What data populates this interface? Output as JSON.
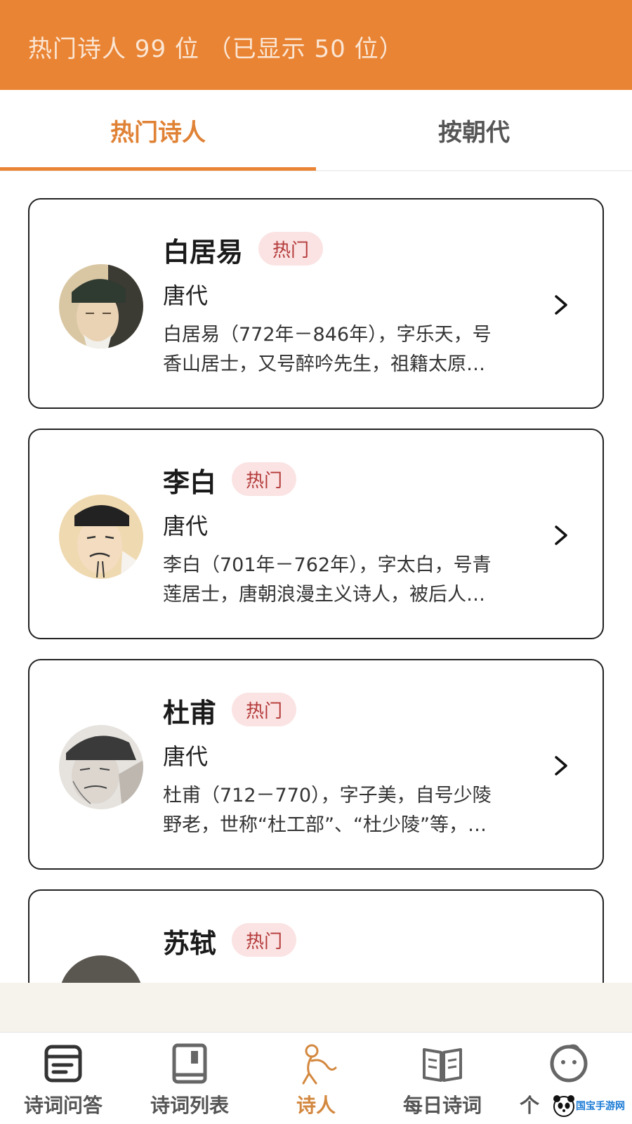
{
  "header": {
    "title": "热门诗人 99 位  （已显示 50 位）"
  },
  "tabs": [
    {
      "label": "热门诗人",
      "active": true
    },
    {
      "label": "按朝代",
      "active": false
    }
  ],
  "poets": [
    {
      "name": "白居易",
      "badge": "热门",
      "dynasty": "唐代",
      "desc_line1": "白居易（772年－846年），字乐天，号",
      "desc_line2": "香山居士，又号醉吟先生，祖籍太原…"
    },
    {
      "name": "李白",
      "badge": "热门",
      "dynasty": "唐代",
      "desc_line1": "李白（701年－762年），字太白，号青",
      "desc_line2": "莲居士，唐朝浪漫主义诗人，被后人…"
    },
    {
      "name": "杜甫",
      "badge": "热门",
      "dynasty": "唐代",
      "desc_line1": "杜甫（712－770），字子美，自号少陵",
      "desc_line2": "野老，世称“杜工部”、“杜少陵”等，…"
    },
    {
      "name": "苏轼",
      "badge": "热门",
      "dynasty": "",
      "desc_line1": "",
      "desc_line2": ""
    }
  ],
  "bottom_nav": [
    {
      "label": "诗词问答",
      "icon": "qa-icon",
      "active": false
    },
    {
      "label": "诗词列表",
      "icon": "book-icon",
      "active": false
    },
    {
      "label": "诗人",
      "icon": "poet-icon",
      "active": true
    },
    {
      "label": "每日诗词",
      "icon": "open-book-icon",
      "active": false
    },
    {
      "label": "个",
      "icon": "profile-face-icon",
      "active": false
    }
  ],
  "watermark": {
    "text": "国宝手游网"
  },
  "colors": {
    "accent": "#e98434",
    "badge_bg": "#fbe3e3",
    "badge_text": "#b43a3a",
    "active_nav": "#d3883f"
  }
}
